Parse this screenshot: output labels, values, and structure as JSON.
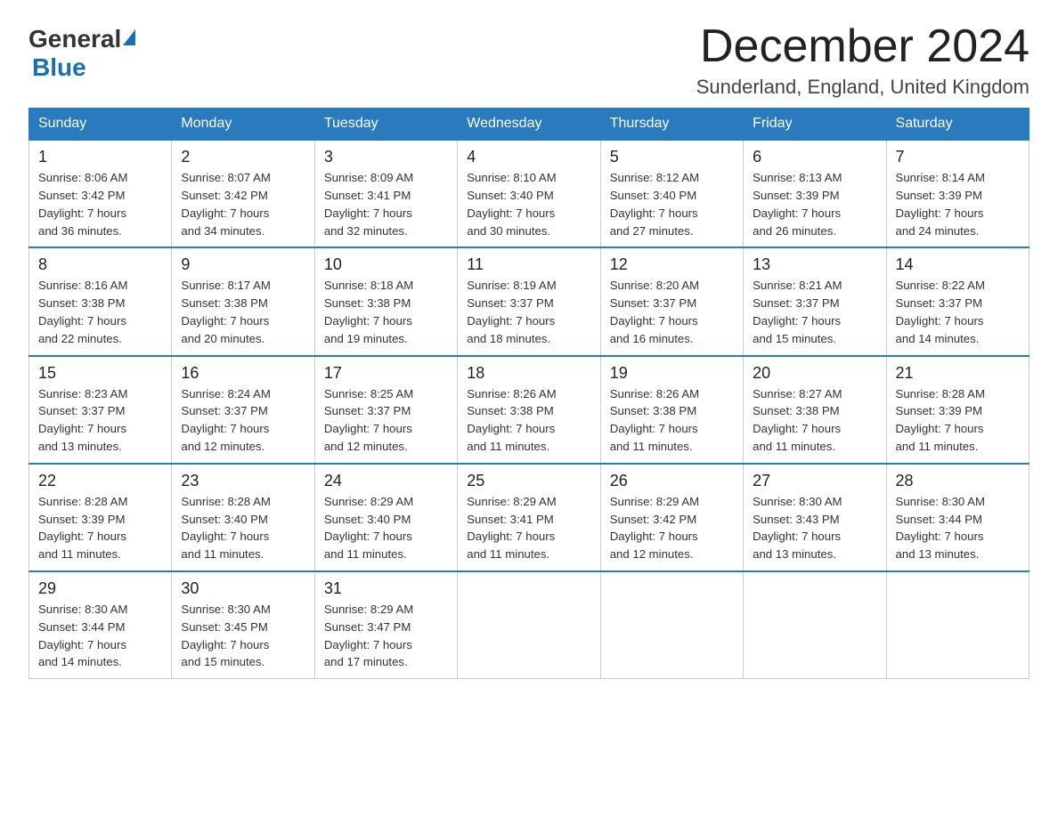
{
  "header": {
    "logo_general": "General",
    "logo_blue": "Blue",
    "month_title": "December 2024",
    "location": "Sunderland, England, United Kingdom"
  },
  "days_of_week": [
    "Sunday",
    "Monday",
    "Tuesday",
    "Wednesday",
    "Thursday",
    "Friday",
    "Saturday"
  ],
  "weeks": [
    [
      {
        "day": "1",
        "sunrise": "Sunrise: 8:06 AM",
        "sunset": "Sunset: 3:42 PM",
        "daylight": "Daylight: 7 hours and 36 minutes."
      },
      {
        "day": "2",
        "sunrise": "Sunrise: 8:07 AM",
        "sunset": "Sunset: 3:42 PM",
        "daylight": "Daylight: 7 hours and 34 minutes."
      },
      {
        "day": "3",
        "sunrise": "Sunrise: 8:09 AM",
        "sunset": "Sunset: 3:41 PM",
        "daylight": "Daylight: 7 hours and 32 minutes."
      },
      {
        "day": "4",
        "sunrise": "Sunrise: 8:10 AM",
        "sunset": "Sunset: 3:40 PM",
        "daylight": "Daylight: 7 hours and 30 minutes."
      },
      {
        "day": "5",
        "sunrise": "Sunrise: 8:12 AM",
        "sunset": "Sunset: 3:40 PM",
        "daylight": "Daylight: 7 hours and 27 minutes."
      },
      {
        "day": "6",
        "sunrise": "Sunrise: 8:13 AM",
        "sunset": "Sunset: 3:39 PM",
        "daylight": "Daylight: 7 hours and 26 minutes."
      },
      {
        "day": "7",
        "sunrise": "Sunrise: 8:14 AM",
        "sunset": "Sunset: 3:39 PM",
        "daylight": "Daylight: 7 hours and 24 minutes."
      }
    ],
    [
      {
        "day": "8",
        "sunrise": "Sunrise: 8:16 AM",
        "sunset": "Sunset: 3:38 PM",
        "daylight": "Daylight: 7 hours and 22 minutes."
      },
      {
        "day": "9",
        "sunrise": "Sunrise: 8:17 AM",
        "sunset": "Sunset: 3:38 PM",
        "daylight": "Daylight: 7 hours and 20 minutes."
      },
      {
        "day": "10",
        "sunrise": "Sunrise: 8:18 AM",
        "sunset": "Sunset: 3:38 PM",
        "daylight": "Daylight: 7 hours and 19 minutes."
      },
      {
        "day": "11",
        "sunrise": "Sunrise: 8:19 AM",
        "sunset": "Sunset: 3:37 PM",
        "daylight": "Daylight: 7 hours and 18 minutes."
      },
      {
        "day": "12",
        "sunrise": "Sunrise: 8:20 AM",
        "sunset": "Sunset: 3:37 PM",
        "daylight": "Daylight: 7 hours and 16 minutes."
      },
      {
        "day": "13",
        "sunrise": "Sunrise: 8:21 AM",
        "sunset": "Sunset: 3:37 PM",
        "daylight": "Daylight: 7 hours and 15 minutes."
      },
      {
        "day": "14",
        "sunrise": "Sunrise: 8:22 AM",
        "sunset": "Sunset: 3:37 PM",
        "daylight": "Daylight: 7 hours and 14 minutes."
      }
    ],
    [
      {
        "day": "15",
        "sunrise": "Sunrise: 8:23 AM",
        "sunset": "Sunset: 3:37 PM",
        "daylight": "Daylight: 7 hours and 13 minutes."
      },
      {
        "day": "16",
        "sunrise": "Sunrise: 8:24 AM",
        "sunset": "Sunset: 3:37 PM",
        "daylight": "Daylight: 7 hours and 12 minutes."
      },
      {
        "day": "17",
        "sunrise": "Sunrise: 8:25 AM",
        "sunset": "Sunset: 3:37 PM",
        "daylight": "Daylight: 7 hours and 12 minutes."
      },
      {
        "day": "18",
        "sunrise": "Sunrise: 8:26 AM",
        "sunset": "Sunset: 3:38 PM",
        "daylight": "Daylight: 7 hours and 11 minutes."
      },
      {
        "day": "19",
        "sunrise": "Sunrise: 8:26 AM",
        "sunset": "Sunset: 3:38 PM",
        "daylight": "Daylight: 7 hours and 11 minutes."
      },
      {
        "day": "20",
        "sunrise": "Sunrise: 8:27 AM",
        "sunset": "Sunset: 3:38 PM",
        "daylight": "Daylight: 7 hours and 11 minutes."
      },
      {
        "day": "21",
        "sunrise": "Sunrise: 8:28 AM",
        "sunset": "Sunset: 3:39 PM",
        "daylight": "Daylight: 7 hours and 11 minutes."
      }
    ],
    [
      {
        "day": "22",
        "sunrise": "Sunrise: 8:28 AM",
        "sunset": "Sunset: 3:39 PM",
        "daylight": "Daylight: 7 hours and 11 minutes."
      },
      {
        "day": "23",
        "sunrise": "Sunrise: 8:28 AM",
        "sunset": "Sunset: 3:40 PM",
        "daylight": "Daylight: 7 hours and 11 minutes."
      },
      {
        "day": "24",
        "sunrise": "Sunrise: 8:29 AM",
        "sunset": "Sunset: 3:40 PM",
        "daylight": "Daylight: 7 hours and 11 minutes."
      },
      {
        "day": "25",
        "sunrise": "Sunrise: 8:29 AM",
        "sunset": "Sunset: 3:41 PM",
        "daylight": "Daylight: 7 hours and 11 minutes."
      },
      {
        "day": "26",
        "sunrise": "Sunrise: 8:29 AM",
        "sunset": "Sunset: 3:42 PM",
        "daylight": "Daylight: 7 hours and 12 minutes."
      },
      {
        "day": "27",
        "sunrise": "Sunrise: 8:30 AM",
        "sunset": "Sunset: 3:43 PM",
        "daylight": "Daylight: 7 hours and 13 minutes."
      },
      {
        "day": "28",
        "sunrise": "Sunrise: 8:30 AM",
        "sunset": "Sunset: 3:44 PM",
        "daylight": "Daylight: 7 hours and 13 minutes."
      }
    ],
    [
      {
        "day": "29",
        "sunrise": "Sunrise: 8:30 AM",
        "sunset": "Sunset: 3:44 PM",
        "daylight": "Daylight: 7 hours and 14 minutes."
      },
      {
        "day": "30",
        "sunrise": "Sunrise: 8:30 AM",
        "sunset": "Sunset: 3:45 PM",
        "daylight": "Daylight: 7 hours and 15 minutes."
      },
      {
        "day": "31",
        "sunrise": "Sunrise: 8:29 AM",
        "sunset": "Sunset: 3:47 PM",
        "daylight": "Daylight: 7 hours and 17 minutes."
      },
      null,
      null,
      null,
      null
    ]
  ]
}
